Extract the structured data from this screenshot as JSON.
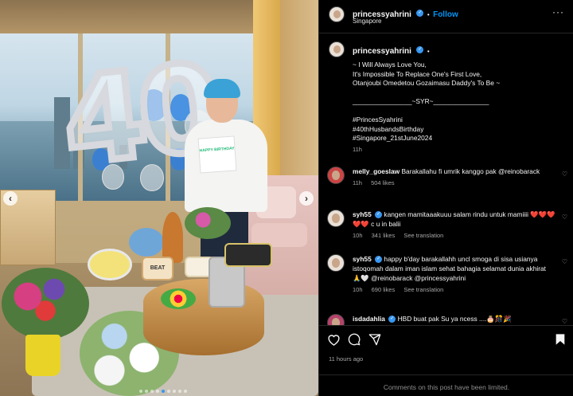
{
  "photo": {
    "balloon_text": "40",
    "card_text": "HAPPY BIRTHDAY",
    "cake_text": "BEAT",
    "carousel": {
      "total": 9,
      "active_index": 4
    }
  },
  "header": {
    "username": "princessyahrini",
    "dot": "•",
    "follow_label": "Follow",
    "location": "Singapore",
    "more": "···"
  },
  "caption": {
    "username": "princessyahrini",
    "dot": "•",
    "lines": [
      "~ I Will Always Love You,",
      "It's Impossible To Replace One's First Love,",
      "Otanjoubi Omedetou Gozaimasu Daddy's To Be ~",
      "",
      "________________~SYR~_______________",
      "",
      "#PrincesSyahrini",
      "#40thHusbandsBirthday",
      "#Singapore_21stJune2024"
    ],
    "time": "11h"
  },
  "comments": [
    {
      "username": "melly_goeslaw",
      "verified": false,
      "text": "Barakallahu fi umrik kanggo pak @reinobarack",
      "time": "11h",
      "likes": "504 likes",
      "see_translation": ""
    },
    {
      "username": "syh55",
      "verified": true,
      "text": "kangen mamitaaakuuu salam rindu untuk mamiiii ❤️❤️❤️❤️❤️ c u in balii",
      "time": "10h",
      "likes": "341 likes",
      "see_translation": "See translation"
    },
    {
      "username": "syh55",
      "verified": true,
      "text": "happy b'day barakallahh uncl smoga di sisa usianya istoqomah dalam iman islam sehat bahagia selamat dunia akhirat 🙏🤍 @reinobarack @princessyahrini",
      "time": "10h",
      "likes": "690 likes",
      "see_translation": "See translation"
    },
    {
      "username": "isdadahlia",
      "verified": true,
      "text": "HBD buat pak Su ya ncess ....🎂🎊🎉",
      "time": "",
      "likes": "",
      "see_translation": ""
    }
  ],
  "actions": {
    "like_icon": "heart-icon",
    "comment_icon": "comment-icon",
    "share_icon": "share-icon",
    "save_icon": "bookmark-icon"
  },
  "time_ago": "11 hours ago",
  "comments_limited": "Comments on this post have been limited."
}
